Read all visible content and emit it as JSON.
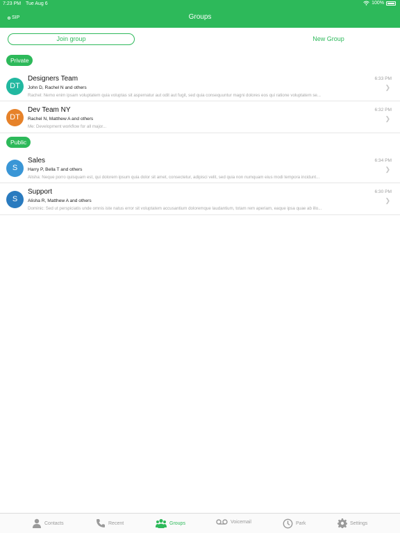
{
  "status": {
    "time": "7:23 PM",
    "date": "Tue Aug 6",
    "battery": "100%"
  },
  "header": {
    "sip": "SIP",
    "title": "Groups"
  },
  "actions": {
    "join_label": "Join group",
    "new_label": "New Group"
  },
  "sections": {
    "private": "Private",
    "public": "Public"
  },
  "groups": [
    {
      "initials": "DT",
      "name": "Designers Team",
      "members": "John D, Rachel N and others",
      "preview": "Rachel: Nemo enim ipsam voluptatem quia voluptas sit aspernatur aut odit aut fugit, sed quia consequuntur magni dolores eos qui ratione voluptatem se...",
      "time": "6:33 PM",
      "color": "#22b8a0"
    },
    {
      "initials": "DT",
      "name": "Dev Team NY",
      "members": "Rachel N, Matthew A and others",
      "preview": "Me: Development workflow for all major...",
      "time": "6:32 PM",
      "color": "#e6822a"
    },
    {
      "initials": "S",
      "name": "Sales",
      "members": "Harry P, Bella T and others",
      "preview": "Alisha: Neque porro quisquam est, qui dolorem ipsum quia dolor sit amet, consectetur, adipisci velit, sed quia non numquam eius modi tempora incidunt...",
      "time": "6:34 PM",
      "color": "#3a96d6"
    },
    {
      "initials": "S",
      "name": "Support",
      "members": "Alisha R, Matthew A and others",
      "preview": "Dominic: Sed ut perspiciatis unde omnis iste natus error sit voluptatem accusantium doloremque laudantium, totam rem aperiam, eaque ipsa quae ab illo...",
      "time": "6:30 PM",
      "color": "#2a7bbf"
    }
  ],
  "tabs": {
    "contacts": "Contacts",
    "recent": "Recent",
    "groups": "Groups",
    "voicemail": "Voicemail",
    "park": "Park",
    "settings": "Settings"
  },
  "colors": {
    "accent": "#2db95a",
    "muted": "#9a9a9a"
  }
}
